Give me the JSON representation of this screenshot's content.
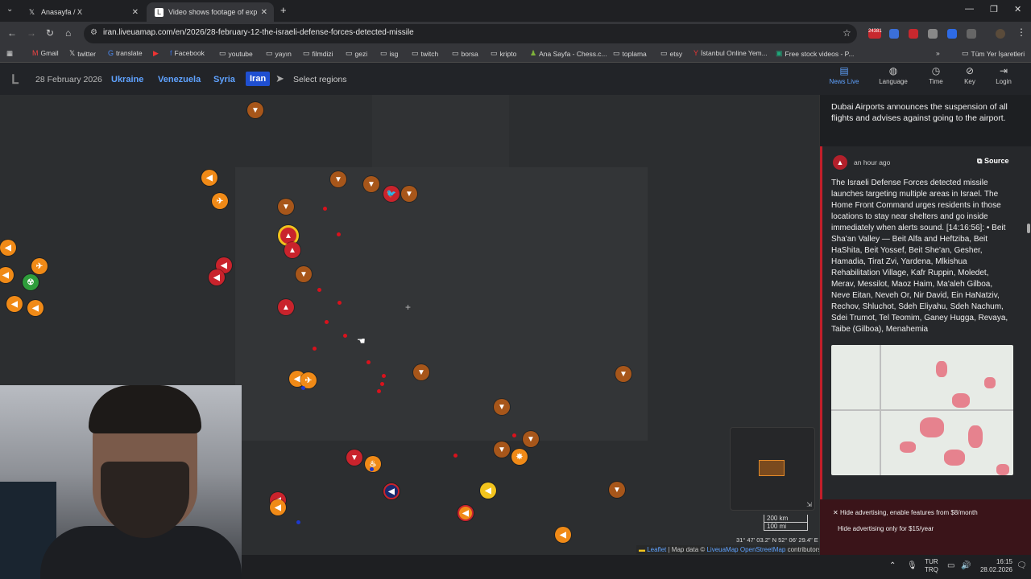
{
  "browser": {
    "tabs": [
      {
        "title": "Anasayfa / X"
      },
      {
        "title": "Video shows footage of explos"
      }
    ],
    "url": "iran.liveuamap.com/en/2026/28-february-12-the-israeli-defense-forces-detected-missile",
    "bookmarks": [
      "Gmail",
      "twitter",
      "translate",
      "Facebook",
      "youtube",
      "yayın",
      "filmdizi",
      "gezi",
      "isg",
      "twitch",
      "borsa",
      "kripto",
      "Ana Sayfa - Chess.c...",
      "toplama",
      "etsy",
      "İstanbul Online Yem...",
      "Free stock videos - P..."
    ],
    "all_bookmarks": "Tüm Yer İşaretleri",
    "ext_badge": "24381"
  },
  "site": {
    "date": "28 February 2026",
    "regions": [
      "Ukraine",
      "Venezuela",
      "Syria",
      "Iran"
    ],
    "active_region": "Iran",
    "select_regions": "Select regions",
    "sidebar_tabs": [
      "News Live",
      "Language",
      "Time",
      "Key",
      "Login"
    ],
    "active_sidebar_tab": "News Live"
  },
  "map": {
    "scale": [
      "200 km",
      "100 mi"
    ],
    "coords": "31° 47' 03.2\" N 52° 06' 29.4\" E",
    "attribution": {
      "leaflet": "Leaflet",
      "sep": " | Map data © ",
      "liveuamap": "LiveuaMap",
      "osm": "OpenStreetMap",
      "tail": " contributors"
    }
  },
  "news": {
    "top_item": "Dubai Airports announces the suspension of all flights and advises against going to the airport.",
    "card": {
      "time": "an hour ago",
      "source": "Source",
      "body": "The Israeli Defense Forces detected missile launches targeting multiple areas in Israel. The Home Front Command urges residents in those locations to stay near shelters and go inside immediately when alerts sound. [14:16:56]: • Beit Sha'an Valley — Beit Alfa and Heftziba, Beit HaShita, Beit Yossef, Beit She'an, Gesher, Hamadia, Tirat Zvi, Yardena, Mlkishua Rehabilitation Village, Kafr Ruppin, Moledet, Merav, Messilot, Maoz Haim, Ma'aleh Gilboa, Neve Eitan, Neveh Or, Nir David, Ein HaNatziv, Rechov, Shluchot, Sdeh Eliyahu, Sdeh Nachum, Sdei Trumot, Tel Teomim, Ganey Hugga, Revaya, Taibe (Gilboa), Menahemia"
    },
    "ads": [
      "Hide advertising, enable features from $8/month",
      "Hide advertising only for $15/year"
    ]
  },
  "taskbar": {
    "lang": [
      "TUR",
      "TRQ"
    ],
    "time": "16:15",
    "date": "28.02.2026"
  }
}
